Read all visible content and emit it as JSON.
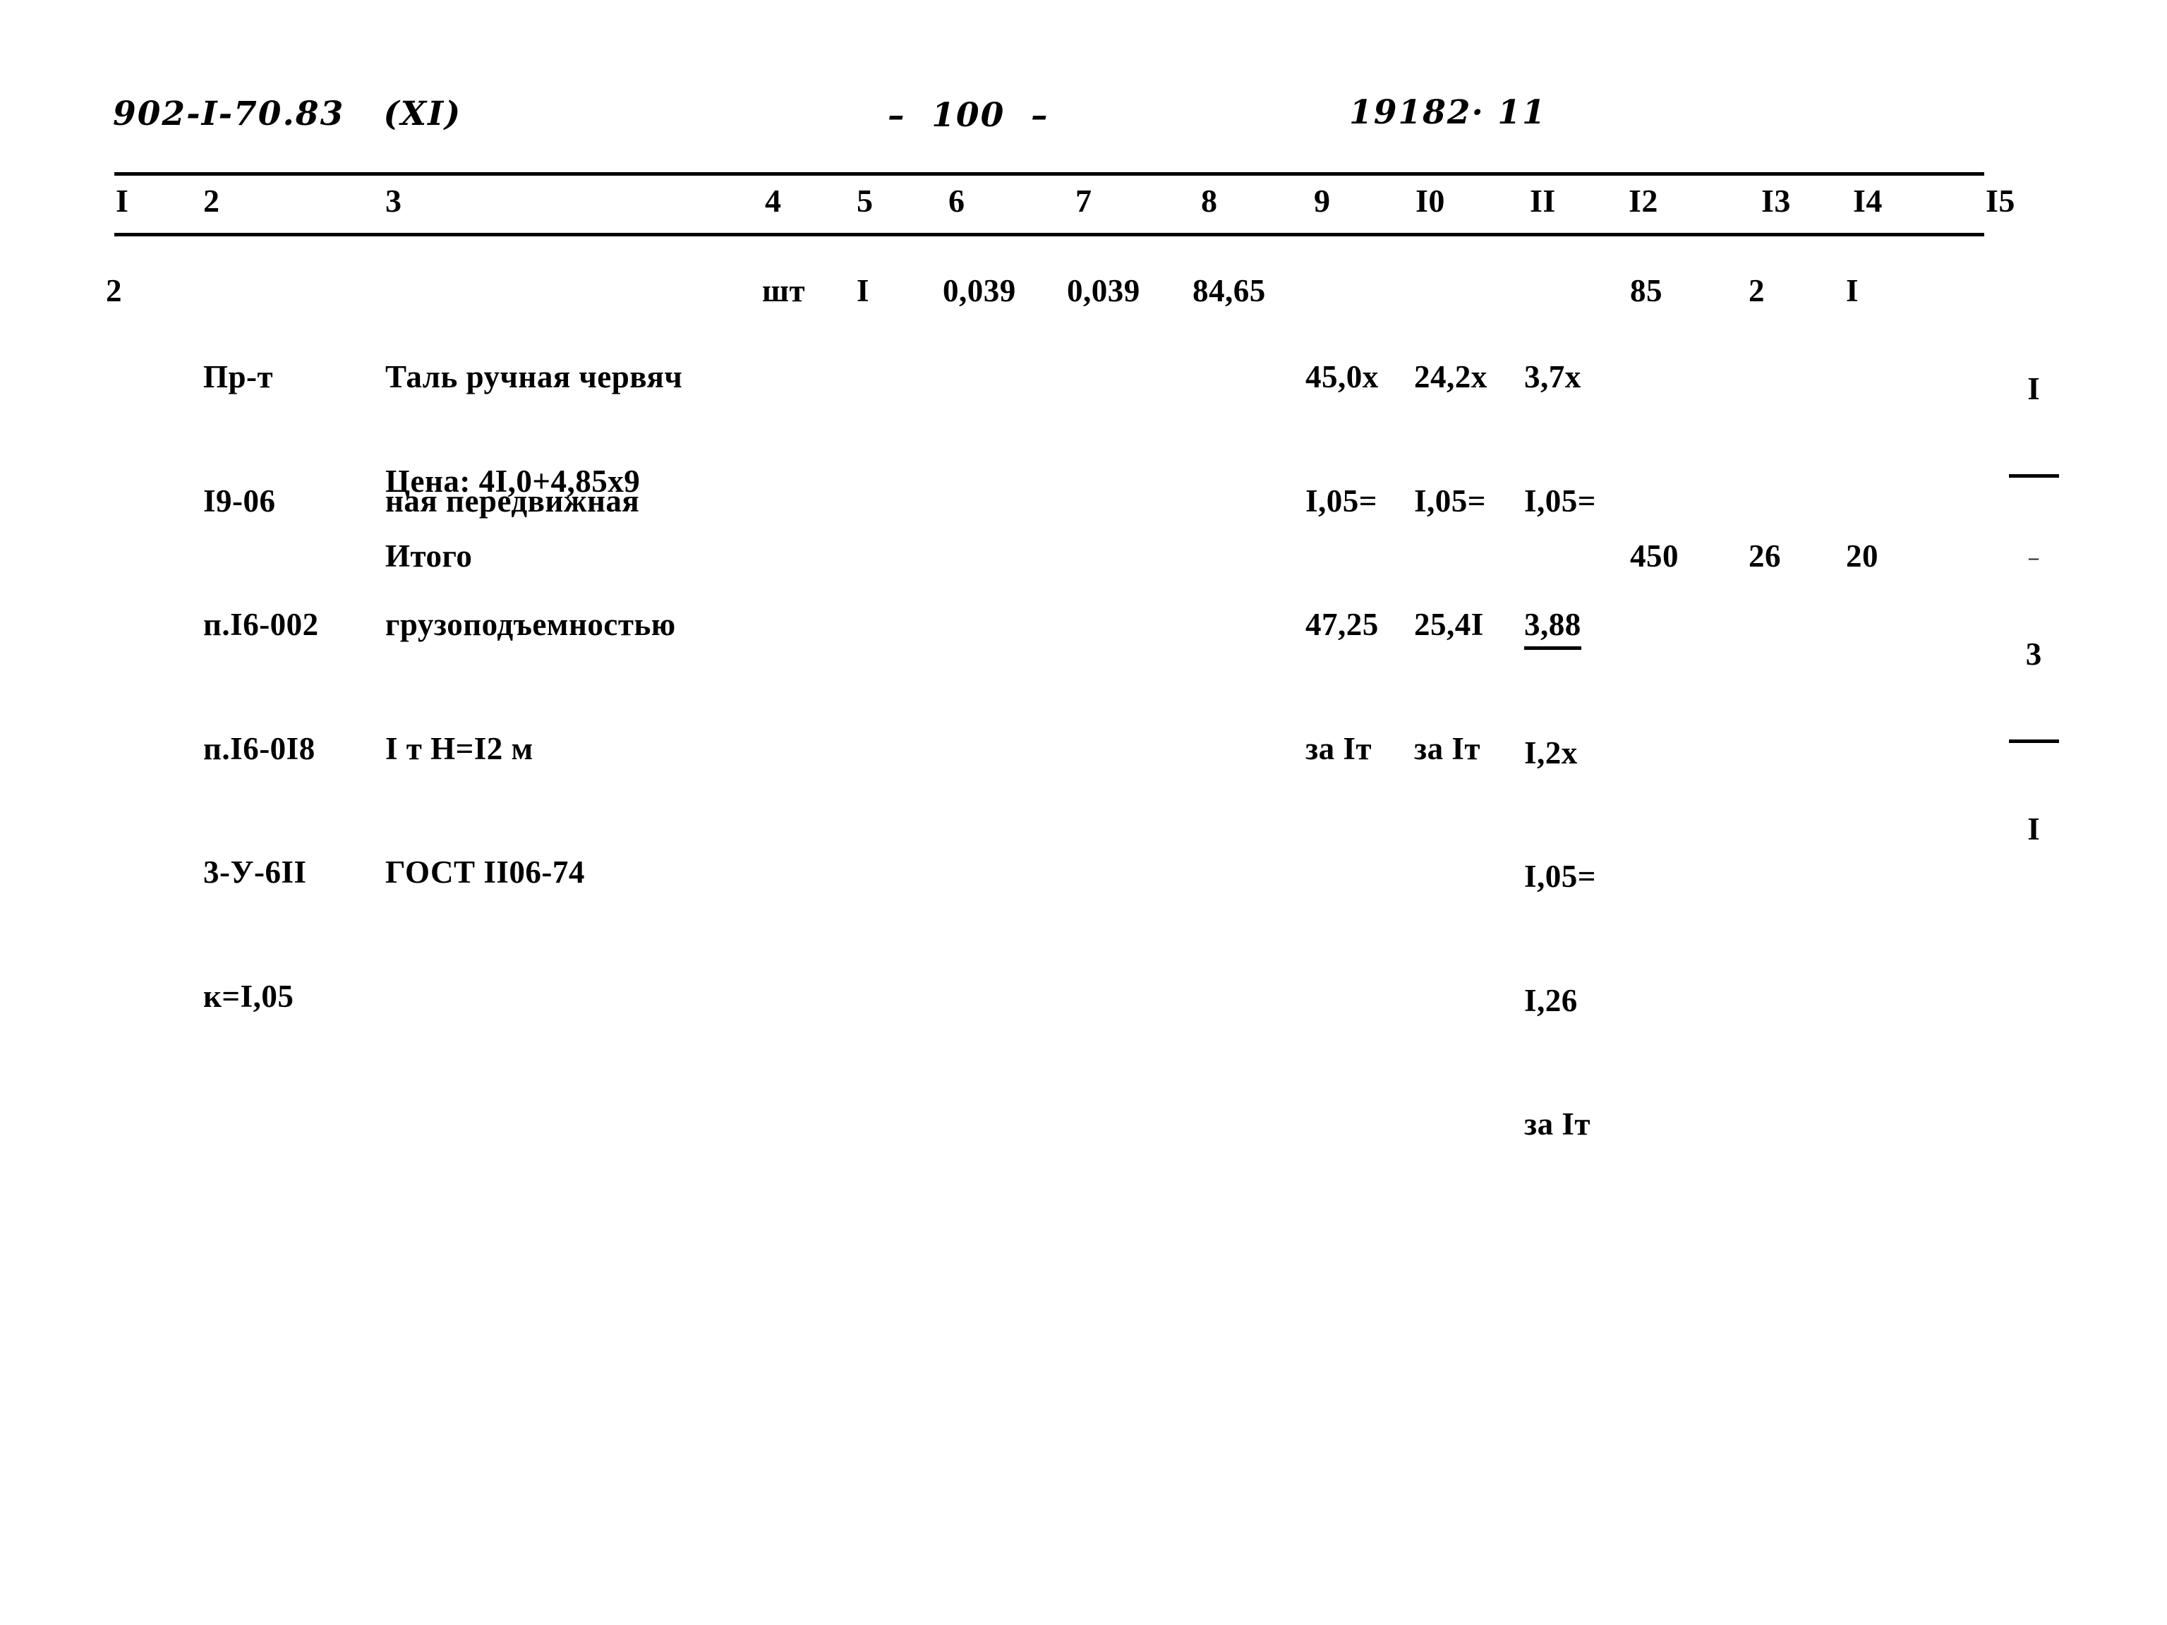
{
  "header": {
    "doc_code": "902-I-70.83   (XI)",
    "page_marker": "–  100  –",
    "sheet_ref": "19182· 11"
  },
  "table": {
    "column_headers": [
      "I",
      "2",
      "3",
      "4",
      "5",
      "6",
      "7",
      "8",
      "9",
      "I0",
      "II",
      "I2",
      "I3",
      "I4",
      "I5"
    ],
    "rows": [
      {
        "col1": "2",
        "col2": [
          "Пр-т",
          "I9-06",
          "п.I6-002",
          "п.I6-0I8",
          "3-У-6II",
          "к=I,05"
        ],
        "col3": [
          "Таль ручная червяч",
          "ная передвижная",
          "грузоподъемностью",
          "I т H=I2 м",
          "ГОСТ II06-74"
        ],
        "col3_price": "Цена: 4I,0+4,85х9",
        "col4": "шт",
        "col5": "I",
        "col6": "0,039",
        "col7": "0,039",
        "col8": "84,65",
        "col9": [
          "45,0х",
          "I,05=",
          "47,25",
          "за Iт"
        ],
        "col10": [
          "24,2х",
          "I,05=",
          "25,4I",
          "за Iт"
        ],
        "col11": [
          "3,7х",
          "I,05=",
          "3,88",
          "I,2х",
          "I,05=",
          "I,26",
          "за Iт"
        ],
        "col11_underlined_index": 2,
        "col12": "85",
        "col13": "2",
        "col14": "I",
        "col15_numerator": "I",
        "col15_denominator": "–"
      }
    ],
    "total_row": {
      "label": "Итого",
      "col12": "450",
      "col13": "26",
      "col14": "20",
      "col15_numerator": "3",
      "col15_denominator": "I"
    }
  },
  "colors": {
    "ink": "#000000",
    "paper": "#ffffff"
  }
}
